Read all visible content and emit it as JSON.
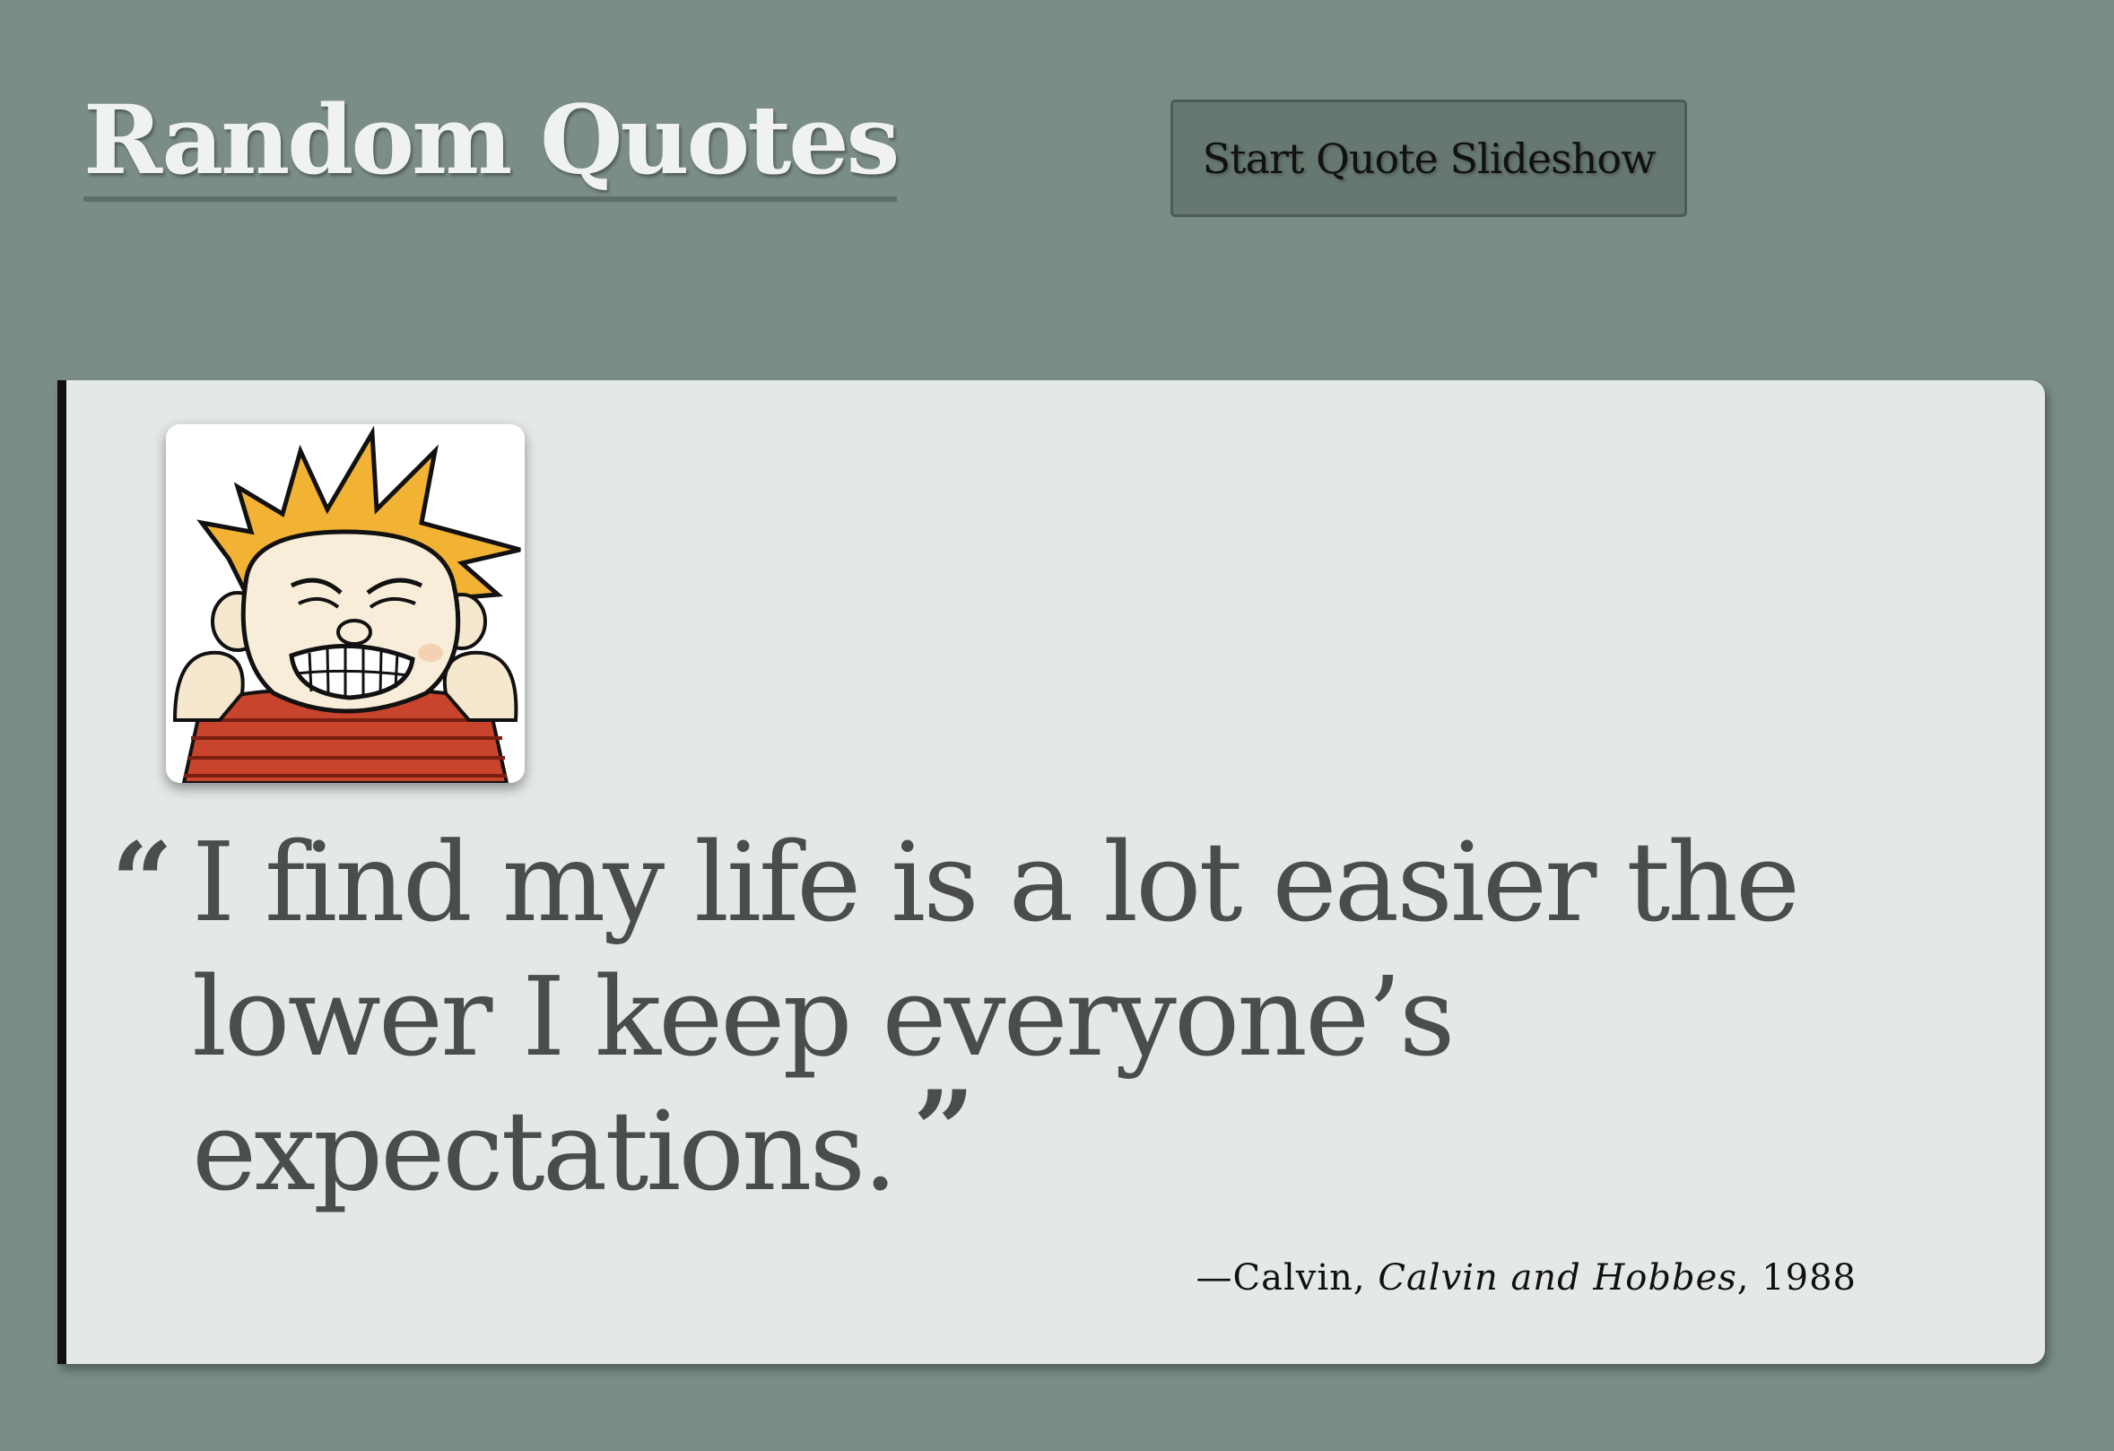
{
  "header": {
    "title": "Random Quotes",
    "slideshow_button_label": "Start Quote Slideshow"
  },
  "quote": {
    "open_mark": "“",
    "text": "I find my life is a lot easier the lower I keep everyone’s expectations.",
    "close_mark": "”",
    "attribution": {
      "dash": "—",
      "author": "Calvin",
      "sep1": ", ",
      "work": "Calvin and Hobbes",
      "sep2": ", ",
      "year": "1988"
    },
    "avatar_icon": "calvin-angry-portrait"
  },
  "colors": {
    "background": "#7b8d87",
    "card": "#e4e8e7",
    "card_border": "#111111",
    "button": "#66786f",
    "quote_text": "#4a4d4c"
  }
}
